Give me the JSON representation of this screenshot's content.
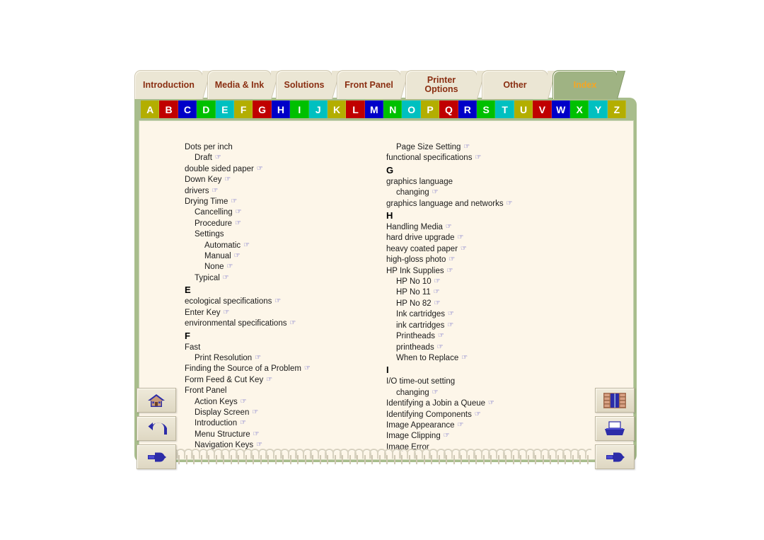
{
  "tabs": [
    {
      "label": "Introduction",
      "active": false
    },
    {
      "label": "Media & Ink",
      "active": false
    },
    {
      "label": "Solutions",
      "active": false
    },
    {
      "label": "Front Panel",
      "active": false
    },
    {
      "label": "Printer Options",
      "active": false
    },
    {
      "label": "Other",
      "active": false
    },
    {
      "label": "Index",
      "active": true
    }
  ],
  "alphabet": [
    {
      "letter": "A",
      "color": "#b3ae00"
    },
    {
      "letter": "B",
      "color": "#c00000"
    },
    {
      "letter": "C",
      "color": "#0000c8"
    },
    {
      "letter": "D",
      "color": "#00c000"
    },
    {
      "letter": "E",
      "color": "#00c0c0"
    },
    {
      "letter": "F",
      "color": "#b3ae00"
    },
    {
      "letter": "G",
      "color": "#c00000"
    },
    {
      "letter": "H",
      "color": "#0000c8"
    },
    {
      "letter": "I",
      "color": "#00c000"
    },
    {
      "letter": "J",
      "color": "#00c0c0"
    },
    {
      "letter": "K",
      "color": "#b3ae00"
    },
    {
      "letter": "L",
      "color": "#c00000"
    },
    {
      "letter": "M",
      "color": "#0000c8"
    },
    {
      "letter": "N",
      "color": "#00c000"
    },
    {
      "letter": "O",
      "color": "#00c0c0"
    },
    {
      "letter": "P",
      "color": "#b3ae00"
    },
    {
      "letter": "Q",
      "color": "#c00000"
    },
    {
      "letter": "R",
      "color": "#0000c8"
    },
    {
      "letter": "S",
      "color": "#00c000"
    },
    {
      "letter": "T",
      "color": "#00c0c0"
    },
    {
      "letter": "U",
      "color": "#b3ae00"
    },
    {
      "letter": "V",
      "color": "#c00000"
    },
    {
      "letter": "W",
      "color": "#0000c8"
    },
    {
      "letter": "X",
      "color": "#00c000"
    },
    {
      "letter": "Y",
      "color": "#00c0c0"
    },
    {
      "letter": "Z",
      "color": "#b3ae00"
    }
  ],
  "index": {
    "left_column": [
      {
        "text": "Dots per inch",
        "level": 1,
        "link": false,
        "heading": false
      },
      {
        "text": "Draft",
        "level": 2,
        "link": true,
        "heading": false
      },
      {
        "text": "double sided paper",
        "level": 1,
        "link": true,
        "heading": false
      },
      {
        "text": "Down Key",
        "level": 1,
        "link": true,
        "heading": false
      },
      {
        "text": "drivers",
        "level": 1,
        "link": true,
        "heading": false
      },
      {
        "text": "Drying Time",
        "level": 1,
        "link": true,
        "heading": false
      },
      {
        "text": "Cancelling",
        "level": 2,
        "link": true,
        "heading": false
      },
      {
        "text": "Procedure",
        "level": 2,
        "link": true,
        "heading": false
      },
      {
        "text": "Settings",
        "level": 2,
        "link": false,
        "heading": false
      },
      {
        "text": "Automatic",
        "level": 3,
        "link": true,
        "heading": false
      },
      {
        "text": "Manual",
        "level": 3,
        "link": true,
        "heading": false
      },
      {
        "text": "None",
        "level": 3,
        "link": true,
        "heading": false
      },
      {
        "text": "Typical",
        "level": 2,
        "link": true,
        "heading": false
      },
      {
        "text": "E",
        "level": 1,
        "link": false,
        "heading": true
      },
      {
        "text": "ecological specifications",
        "level": 1,
        "link": true,
        "heading": false
      },
      {
        "text": "Enter Key",
        "level": 1,
        "link": true,
        "heading": false
      },
      {
        "text": "environmental specifications",
        "level": 1,
        "link": true,
        "heading": false
      },
      {
        "text": "F",
        "level": 1,
        "link": false,
        "heading": true
      },
      {
        "text": "Fast",
        "level": 1,
        "link": false,
        "heading": false
      },
      {
        "text": "Print Resolution",
        "level": 2,
        "link": true,
        "heading": false
      },
      {
        "text": "Finding the Source of a Problem",
        "level": 1,
        "link": true,
        "heading": false
      },
      {
        "text": "Form Feed & Cut Key",
        "level": 1,
        "link": true,
        "heading": false
      },
      {
        "text": "Front Panel",
        "level": 1,
        "link": false,
        "heading": false
      },
      {
        "text": "Action Keys",
        "level": 2,
        "link": true,
        "heading": false
      },
      {
        "text": "Display Screen",
        "level": 2,
        "link": true,
        "heading": false
      },
      {
        "text": "Introduction",
        "level": 2,
        "link": true,
        "heading": false
      },
      {
        "text": "Menu Structure",
        "level": 2,
        "link": true,
        "heading": false
      },
      {
        "text": "Navigation Keys",
        "level": 2,
        "link": true,
        "heading": false
      }
    ],
    "right_column": [
      {
        "text": "Page Size Setting",
        "level": 2,
        "link": true,
        "heading": false
      },
      {
        "text": "functional specifications",
        "level": 1,
        "link": true,
        "heading": false
      },
      {
        "text": "G",
        "level": 1,
        "link": false,
        "heading": true
      },
      {
        "text": "graphics language",
        "level": 1,
        "link": false,
        "heading": false
      },
      {
        "text": "changing",
        "level": 2,
        "link": true,
        "heading": false
      },
      {
        "text": "graphics language and networks",
        "level": 1,
        "link": true,
        "heading": false
      },
      {
        "text": "H",
        "level": 1,
        "link": false,
        "heading": true
      },
      {
        "text": "Handling Media",
        "level": 1,
        "link": true,
        "heading": false
      },
      {
        "text": "hard drive upgrade",
        "level": 1,
        "link": true,
        "heading": false
      },
      {
        "text": "heavy coated paper",
        "level": 1,
        "link": true,
        "heading": false
      },
      {
        "text": "high-gloss photo",
        "level": 1,
        "link": true,
        "heading": false
      },
      {
        "text": "HP Ink Supplies",
        "level": 1,
        "link": true,
        "heading": false
      },
      {
        "text": "HP No 10",
        "level": 2,
        "link": true,
        "heading": false
      },
      {
        "text": "HP No 11",
        "level": 2,
        "link": true,
        "heading": false
      },
      {
        "text": "HP No 82",
        "level": 2,
        "link": true,
        "heading": false
      },
      {
        "text": "Ink cartridges",
        "level": 2,
        "link": true,
        "heading": false
      },
      {
        "text": "ink cartridges",
        "level": 2,
        "link": true,
        "heading": false
      },
      {
        "text": "Printheads",
        "level": 2,
        "link": true,
        "heading": false
      },
      {
        "text": "printheads",
        "level": 2,
        "link": true,
        "heading": false
      },
      {
        "text": "When to Replace",
        "level": 2,
        "link": true,
        "heading": false
      },
      {
        "text": "I",
        "level": 1,
        "link": false,
        "heading": true
      },
      {
        "text": "I/O time-out setting",
        "level": 1,
        "link": false,
        "heading": false
      },
      {
        "text": "changing",
        "level": 2,
        "link": true,
        "heading": false
      },
      {
        "text": "Identifying a Jobin a Queue",
        "level": 1,
        "link": true,
        "heading": false
      },
      {
        "text": "Identifying Components",
        "level": 1,
        "link": true,
        "heading": false
      },
      {
        "text": "Image Appearance",
        "level": 1,
        "link": true,
        "heading": false
      },
      {
        "text": "Image Clipping",
        "level": 1,
        "link": true,
        "heading": false
      },
      {
        "text": "Image Error",
        "level": 1,
        "link": false,
        "heading": false
      }
    ]
  },
  "nav_buttons": {
    "left": [
      {
        "name": "home-icon",
        "title": "Home"
      },
      {
        "name": "back-arrow-icon",
        "title": "Back"
      },
      {
        "name": "pointing-hand-icon",
        "title": "Next"
      }
    ],
    "right": [
      {
        "name": "bookshelf-icon",
        "title": "Index"
      },
      {
        "name": "printer-icon",
        "title": "Print"
      },
      {
        "name": "pointing-hand-icon",
        "title": "Go"
      }
    ]
  },
  "link_glyph": "☞",
  "spiral_ring_count": 58
}
